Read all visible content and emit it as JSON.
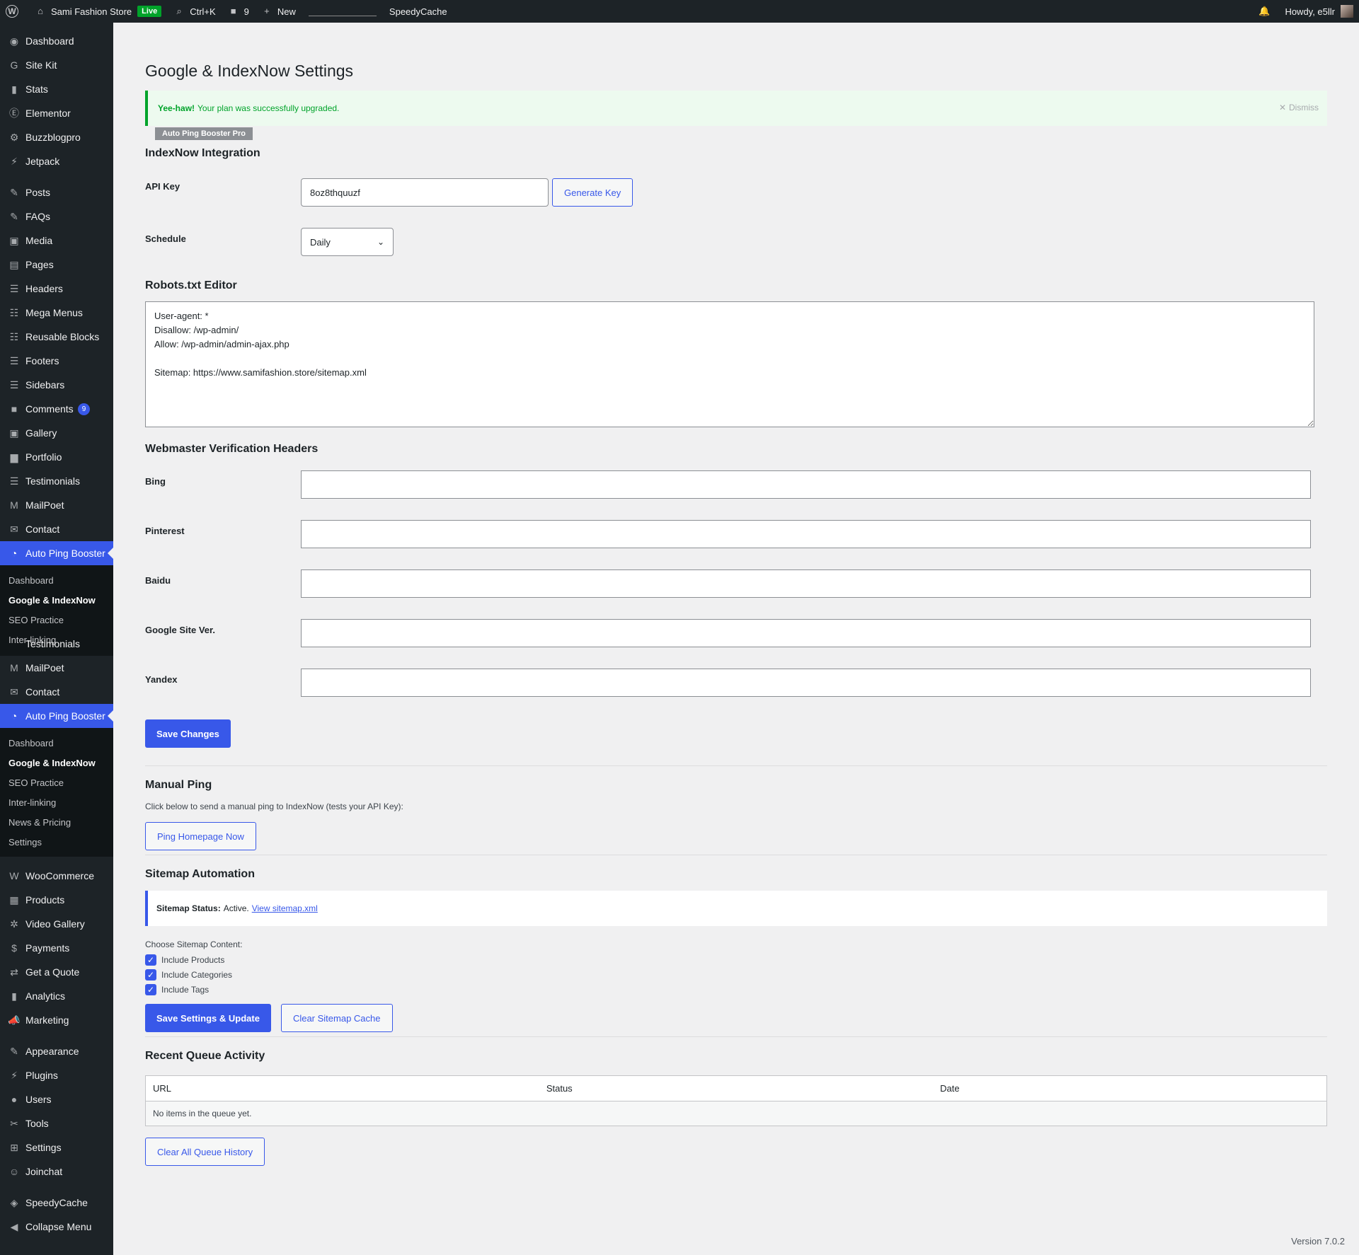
{
  "adminbar": {
    "site_name": "Sami Fashion Store",
    "live_label": "Live",
    "search_shortcut": "Ctrl+K",
    "comments_count": "9",
    "new_label": "New",
    "cache_label": "SpeedyCache",
    "howdy": "Howdy, e5llr"
  },
  "sidebar": {
    "items_top": [
      {
        "label": "Dashboard",
        "icon": "dashboard-icon",
        "glyph": "◉"
      },
      {
        "label": "Site Kit",
        "icon": "google-icon",
        "glyph": "G"
      },
      {
        "label": "Stats",
        "icon": "stats-icon",
        "glyph": "▮"
      },
      {
        "label": "Elementor",
        "icon": "elementor-icon",
        "glyph": "Ⓔ"
      },
      {
        "label": "Buzzblogpro",
        "icon": "gear-icon",
        "glyph": "⚙"
      },
      {
        "label": "Jetpack",
        "icon": "jetpack-icon",
        "glyph": "⚡"
      }
    ],
    "items_content": [
      {
        "label": "Posts",
        "icon": "pin-icon",
        "glyph": "✎"
      },
      {
        "label": "FAQs",
        "icon": "pin-icon",
        "glyph": "✎"
      },
      {
        "label": "Media",
        "icon": "media-icon",
        "glyph": "▣"
      },
      {
        "label": "Pages",
        "icon": "pages-icon",
        "glyph": "▤"
      },
      {
        "label": "Headers",
        "icon": "layout-icon",
        "glyph": "☰"
      },
      {
        "label": "Mega Menus",
        "icon": "layout-icon",
        "glyph": "☷"
      },
      {
        "label": "Reusable Blocks",
        "icon": "layout-icon",
        "glyph": "☷"
      },
      {
        "label": "Footers",
        "icon": "layout-icon",
        "glyph": "☰"
      },
      {
        "label": "Sidebars",
        "icon": "sidebar-icon",
        "glyph": "☰"
      },
      {
        "label": "Comments",
        "icon": "comment-icon",
        "glyph": "■",
        "badge": "9"
      },
      {
        "label": "Gallery",
        "icon": "gallery-icon",
        "glyph": "▣"
      },
      {
        "label": "Portfolio",
        "icon": "portfolio-icon",
        "glyph": "▆"
      },
      {
        "label": "Testimonials",
        "icon": "testimonial-icon",
        "glyph": "☰"
      },
      {
        "label": "MailPoet",
        "icon": "mailpoet-icon",
        "glyph": "M"
      },
      {
        "label": "Contact",
        "icon": "mail-icon",
        "glyph": "✉"
      }
    ],
    "active_label": "Auto Ping Booster",
    "submenu_first": [
      "Dashboard",
      "Google & IndexNow",
      "SEO Practice",
      "Inter-linking"
    ],
    "overlap_label": "Testimonials",
    "items_repeat": [
      {
        "label": "MailPoet",
        "icon": "mailpoet-icon",
        "glyph": "M"
      },
      {
        "label": "Contact",
        "icon": "mail-icon",
        "glyph": "✉"
      }
    ],
    "submenu_second": [
      "Dashboard",
      "Google & IndexNow",
      "SEO Practice",
      "Inter-linking",
      "News & Pricing",
      "Settings"
    ],
    "items_bottom1": [
      {
        "label": "WooCommerce",
        "icon": "woocommerce-icon",
        "glyph": "W"
      },
      {
        "label": "Products",
        "icon": "products-icon",
        "glyph": "▦"
      },
      {
        "label": "Video Gallery",
        "icon": "video-icon",
        "glyph": "✲"
      },
      {
        "label": "Payments",
        "icon": "payments-icon",
        "glyph": "$"
      },
      {
        "label": "Get a Quote",
        "icon": "quote-icon",
        "glyph": "⇄"
      },
      {
        "label": "Analytics",
        "icon": "analytics-icon",
        "glyph": "▮"
      },
      {
        "label": "Marketing",
        "icon": "megaphone-icon",
        "glyph": "📣"
      }
    ],
    "items_bottom2": [
      {
        "label": "Appearance",
        "icon": "brush-icon",
        "glyph": "✎"
      },
      {
        "label": "Plugins",
        "icon": "plugin-icon",
        "glyph": "⚡"
      },
      {
        "label": "Users",
        "icon": "user-icon",
        "glyph": "●"
      },
      {
        "label": "Tools",
        "icon": "wrench-icon",
        "glyph": "✂"
      },
      {
        "label": "Settings",
        "icon": "settings-icon",
        "glyph": "⊞"
      },
      {
        "label": "Joinchat",
        "icon": "chat-icon",
        "glyph": "☺"
      }
    ],
    "items_bottom3": [
      {
        "label": "SpeedyCache",
        "icon": "speedycache-icon",
        "glyph": "◈"
      },
      {
        "label": "Collapse Menu",
        "icon": "collapse-icon",
        "glyph": "◀"
      }
    ]
  },
  "page": {
    "title": "Google & IndexNow Settings",
    "notice_strong": "Yee-haw!",
    "notice_text": "Your plan was successfully upgraded.",
    "dismiss": "Dismiss",
    "pro_badge": "Auto Ping Booster Pro"
  },
  "indexnow": {
    "heading": "IndexNow Integration",
    "api_label": "API Key",
    "api_value": "8oz8thquuzf",
    "generate_label": "Generate Key",
    "schedule_label": "Schedule",
    "schedule_value": "Daily"
  },
  "robots": {
    "heading": "Robots.txt Editor",
    "content": "User-agent: *\nDisallow: /wp-admin/\nAllow: /wp-admin/admin-ajax.php\n\nSitemap: https://www.samifashion.store/sitemap.xml"
  },
  "webmaster": {
    "heading": "Webmaster Verification Headers",
    "fields": [
      "Bing",
      "Pinterest",
      "Baidu",
      "Google Site Ver.",
      "Yandex"
    ],
    "save_label": "Save Changes"
  },
  "manual_ping": {
    "heading": "Manual Ping",
    "desc": "Click below to send a manual ping to IndexNow (tests your API Key):",
    "button": "Ping Homepage Now"
  },
  "sitemap": {
    "heading": "Sitemap Automation",
    "status_label": "Sitemap Status:",
    "status_value": "Active.",
    "status_link": "View sitemap.xml",
    "choose_label": "Choose Sitemap Content:",
    "options": [
      "Include Products",
      "Include Categories",
      "Include Tags"
    ],
    "save_button": "Save Settings & Update",
    "clear_button": "Clear Sitemap Cache"
  },
  "queue": {
    "heading": "Recent Queue Activity",
    "columns": [
      "URL",
      "Status",
      "Date"
    ],
    "empty": "No items in the queue yet.",
    "clear_button": "Clear All Queue History"
  },
  "footer": {
    "version": "Version 7.0.2"
  },
  "colors": {
    "accent": "#3858e9",
    "success": "#00a32a",
    "sidebar": "#1d2327"
  }
}
